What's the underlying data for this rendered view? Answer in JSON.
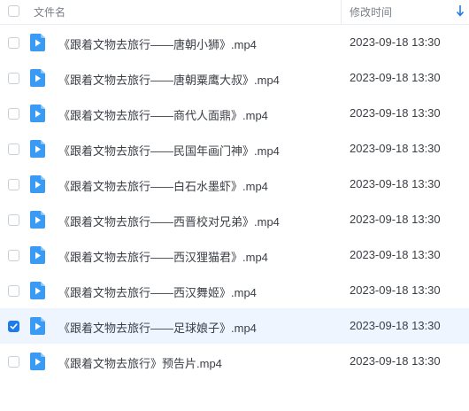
{
  "header": {
    "name_col": "文件名",
    "time_col": "修改时间",
    "sort_icon": "arrow-down-icon"
  },
  "colors": {
    "accent": "#1e7ce8",
    "icon_blue": "#3a9bf4",
    "selected_row": "#eef5fe"
  },
  "files": [
    {
      "name": "《跟着文物去旅行——唐朝小狮》.mp4",
      "time": "2023-09-18 13:30",
      "checked": false
    },
    {
      "name": "《跟着文物去旅行——唐朝粟鹰大叔》.mp4",
      "time": "2023-09-18 13:30",
      "checked": false
    },
    {
      "name": "《跟着文物去旅行——商代人面鼎》.mp4",
      "time": "2023-09-18 13:30",
      "checked": false
    },
    {
      "name": "《跟着文物去旅行——民国年画门神》.mp4",
      "time": "2023-09-18 13:30",
      "checked": false
    },
    {
      "name": "《跟着文物去旅行——白石水墨虾》.mp4",
      "time": "2023-09-18 13:30",
      "checked": false
    },
    {
      "name": "《跟着文物去旅行——西晋校对兄弟》.mp4",
      "time": "2023-09-18 13:30",
      "checked": false
    },
    {
      "name": "《跟着文物去旅行——西汉狸猫君》.mp4",
      "time": "2023-09-18 13:30",
      "checked": false
    },
    {
      "name": "《跟着文物去旅行——西汉舞姬》.mp4",
      "time": "2023-09-18 13:30",
      "checked": false
    },
    {
      "name": "《跟着文物去旅行——足球娘子》.mp4",
      "time": "2023-09-18 13:30",
      "checked": true
    },
    {
      "name": "《跟着文物去旅行》预告片.mp4",
      "time": "2023-09-18 13:30",
      "checked": false
    }
  ]
}
